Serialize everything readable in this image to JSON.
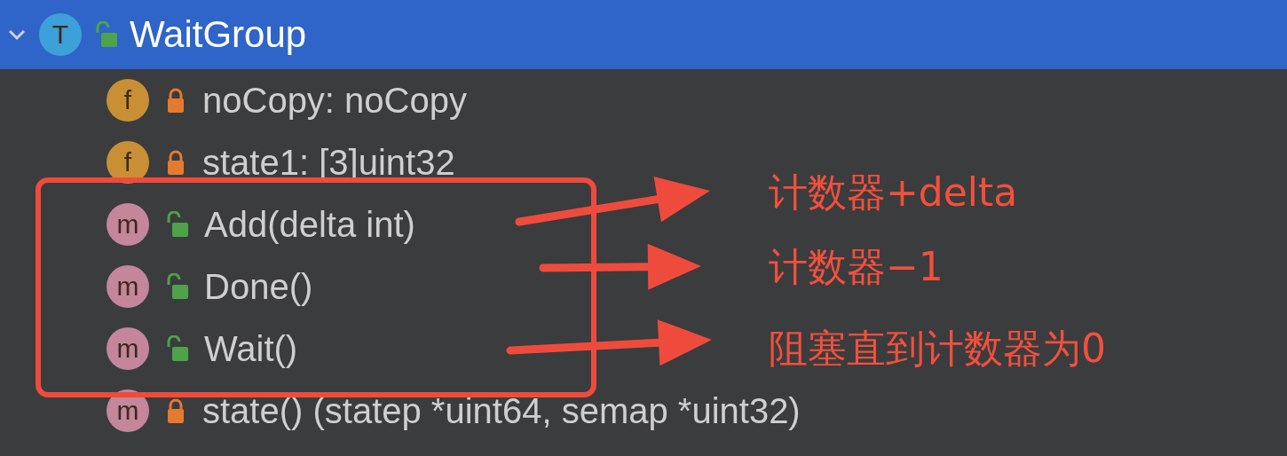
{
  "structure_tree": {
    "name": "WaitGroup",
    "badge": "T",
    "kind": "type",
    "locked": false,
    "expanded": true,
    "selected": true,
    "children": [
      {
        "badge": "f",
        "kind": "field",
        "locked": true,
        "text": "noCopy: noCopy"
      },
      {
        "badge": "f",
        "kind": "field",
        "locked": true,
        "text": "state1: [3]uint32"
      },
      {
        "badge": "m",
        "kind": "method",
        "locked": false,
        "text": "Add(delta int)"
      },
      {
        "badge": "m",
        "kind": "method",
        "locked": false,
        "text": "Done()"
      },
      {
        "badge": "m",
        "kind": "method",
        "locked": false,
        "text": "Wait()"
      },
      {
        "badge": "m",
        "kind": "method",
        "locked": true,
        "text": "state() (statep *uint64, semap *uint32)"
      }
    ]
  },
  "annotations": [
    {
      "label": "计数器+delta"
    },
    {
      "label": "计数器−1"
    },
    {
      "label": "阻塞直到计数器为0"
    }
  ]
}
